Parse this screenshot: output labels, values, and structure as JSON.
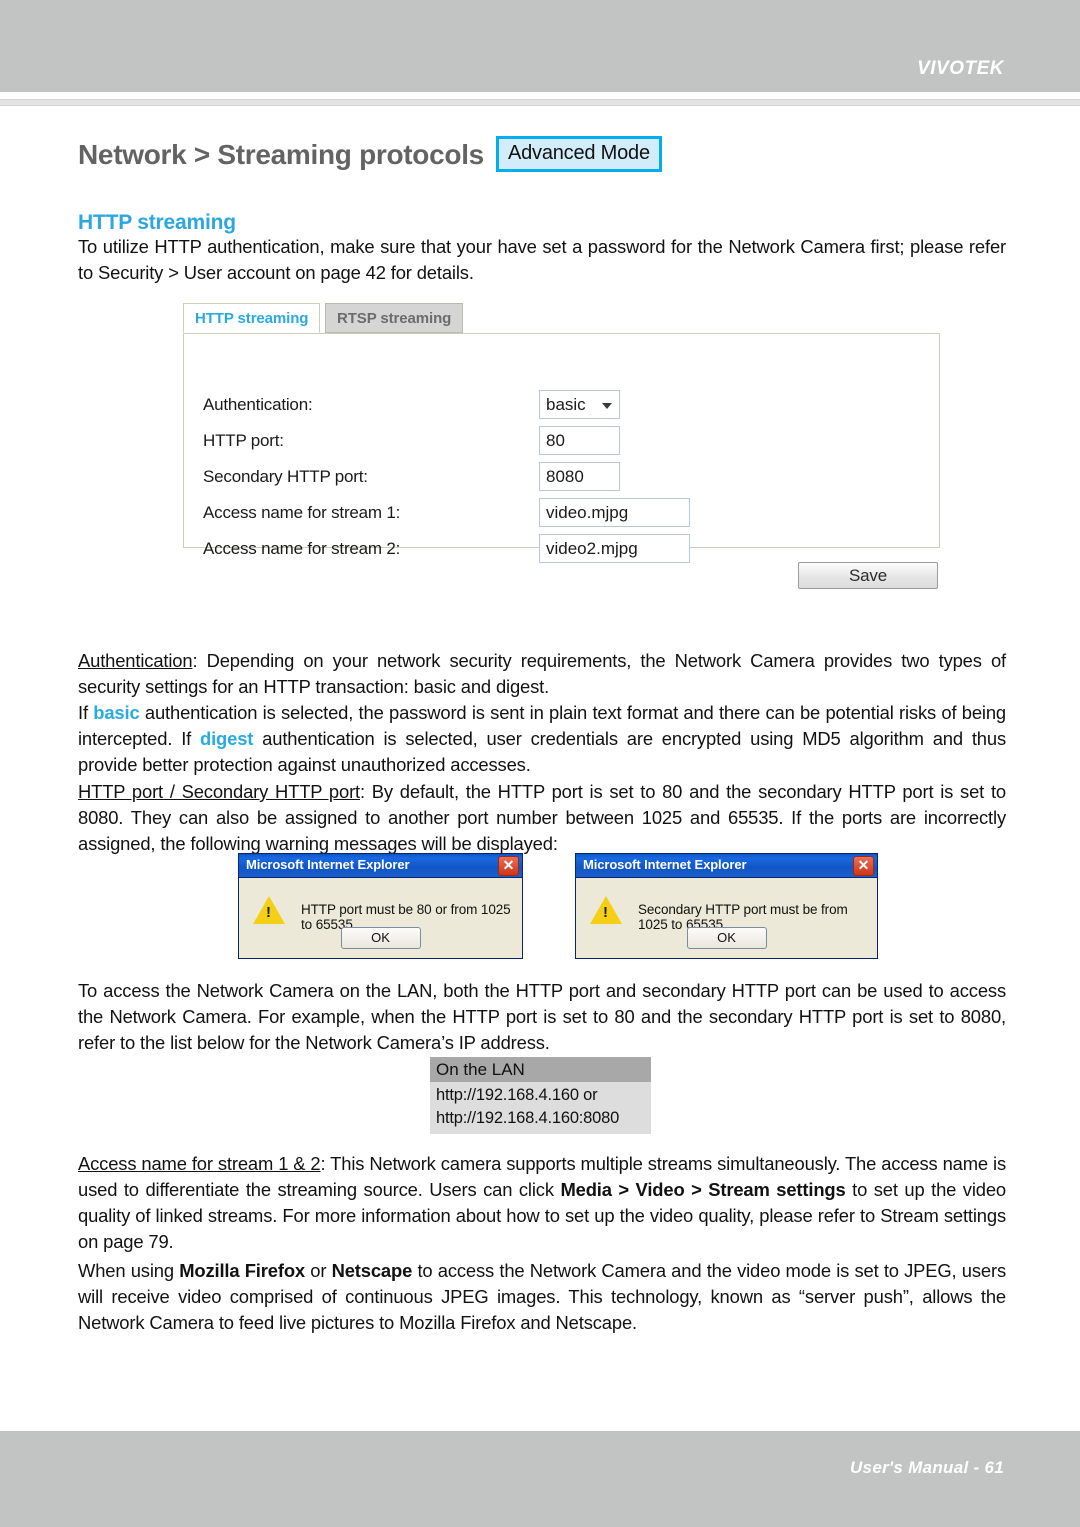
{
  "header": {
    "brand": "VIVOTEK"
  },
  "page_title": {
    "text": "Network > Streaming protocols",
    "badge": "Advanced Mode",
    "badge_border_color": "#00aeef",
    "badge_fill_color": "#d3ecfa"
  },
  "section": {
    "heading": "HTTP streaming",
    "heading_color": "#2ca7e0",
    "intro": "To utilize HTTP authentication, make sure that your have set a password for the Network Camera first; please refer to Security > User account on page 42 for details."
  },
  "panel": {
    "tabs": [
      {
        "label": "HTTP streaming",
        "active": true
      },
      {
        "label": "RTSP streaming",
        "active": false
      }
    ],
    "fields": [
      {
        "label": "Authentication:",
        "value": "basic",
        "type": "select"
      },
      {
        "label": "HTTP port:",
        "value": "80",
        "type": "text"
      },
      {
        "label": "Secondary HTTP port:",
        "value": "8080",
        "type": "text"
      },
      {
        "label": "Access name for stream 1:",
        "value": "video.mjpg",
        "type": "text"
      },
      {
        "label": "Access name for stream 2:",
        "value": "video2.mjpg",
        "type": "text"
      }
    ],
    "save_label": "Save"
  },
  "paragraphs": {
    "authentication": {
      "term": "Authentication",
      "rest": ": Depending on your network security requirements, the Network Camera provides two types of security settings for an HTTP transaction: basic and digest.",
      "line2_pre": "If ",
      "highlight1": "basic",
      "line2_mid": " authentication is selected, the password is sent in plain text format and there can be potential risks of being intercepted. If ",
      "highlight2": "digest",
      "line2_post": " authentication is selected, user credentials are encrypted using MD5 algorithm and thus provide better protection against unauthorized accesses.",
      "highlight_color": "#29abe2"
    },
    "http_port": {
      "term": "HTTP port / Secondary HTTP port",
      "rest": ": By default, the HTTP port is set to 80 and the secondary HTTP port is set to 8080. They can also be assigned to another port number between 1025 and 65535. If the ports are incorrectly assigned, the following warning messages will be displayed:"
    },
    "lan_access": "To access the Network Camera on the LAN, both the HTTP port and secondary HTTP port can be used to access the Network Camera. For example, when the HTTP port is set to 80 and the secondary HTTP port is set to 8080, refer to the list below for the Network Camera’s IP address.",
    "access_name": {
      "term": "Access name for stream 1 & 2",
      "part1": ": This Network camera supports multiple streams simultaneously. The access name is used to differentiate the streaming source. Users can click ",
      "bold1": "Media > Video > Stream settings",
      "part2": " to set up the video quality of linked streams. For more information about how to set up the video quality, please refer to Stream settings on page 79."
    },
    "firefox": {
      "part1": "When using ",
      "bold1": "Mozilla Firefox",
      "part2": " or ",
      "bold2": "Netscape",
      "part3": " to access the Network Camera and the video mode is set to JPEG, users will receive video comprised of continuous JPEG images. This technology, known as “server push”, allows the Network Camera to feed live pictures to Mozilla Firefox and Netscape."
    }
  },
  "dialogs": [
    {
      "title": "Microsoft Internet Explorer",
      "message": "HTTP port must be 80 or from 1025 to 65535",
      "ok_label": "OK",
      "close_label": "✕"
    },
    {
      "title": "Microsoft Internet Explorer",
      "message": "Secondary HTTP port must be from 1025 to 65535",
      "ok_label": "OK",
      "close_label": "✕"
    }
  ],
  "lan_table": {
    "header": "On the LAN",
    "rows": [
      "http://192.168.4.160  or",
      "http://192.168.4.160:8080"
    ]
  },
  "footer": {
    "text": "User's Manual - 61"
  }
}
